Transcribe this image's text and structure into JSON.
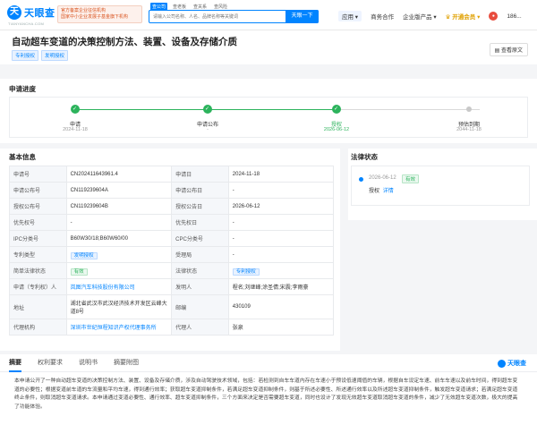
{
  "header": {
    "logo_mark": "天",
    "logo_text": "天眼查",
    "logo_sub": "TIANYANCHA.COM",
    "slogan_line1": "官方备案企业征信机构",
    "slogan_line2": "国家中小企业发展子基金旗下机构",
    "search_tabs": [
      "查公司",
      "查老板",
      "查关系",
      "查风险"
    ],
    "search_placeholder": "请输入公司名称、人名、品牌名称等关键词",
    "search_button": "天眼一下",
    "nav_app": "应用 ▾",
    "nav_items": [
      "商务合作",
      "企业版产品 ▾"
    ],
    "nav_vip": "♛ 开通会员 ▾",
    "nav_user": "186..."
  },
  "title": {
    "text": "自动超车变道的决策控制方法、装置、设备及存储介质",
    "tags": [
      "专利授权",
      "发明授权"
    ],
    "view_original": "查看原文"
  },
  "progress": {
    "title": "申请进度",
    "steps": [
      {
        "label": "申请",
        "date": "2024-11-18"
      },
      {
        "label": "申请公布",
        "date": "-"
      },
      {
        "label": "授权",
        "date": "2026-06-12"
      },
      {
        "label": "预估到期",
        "date": "2044-11-18"
      }
    ]
  },
  "basic_info": {
    "title": "基本信息",
    "rows": [
      {
        "k1": "申请号",
        "v1": "CN202411643961.4",
        "k2": "申请日",
        "v2": "2024-11-18"
      },
      {
        "k1": "申请公布号",
        "v1": "CN119239604A",
        "k2": "申请公布日",
        "v2": "-"
      },
      {
        "k1": "授权公布号",
        "v1": "CN119239604B",
        "k2": "授权公告日",
        "v2": "2026-06-12"
      },
      {
        "k1": "优先权号",
        "v1": "-",
        "k2": "优先权日",
        "v2": "-"
      },
      {
        "k1": "IPC分类号",
        "v1": "B60W30/18;B60W60/00",
        "k2": "CPC分类号",
        "v2": "-"
      },
      {
        "k1": "专利类型",
        "v1": "发明授权",
        "k2": "受理局",
        "v2": "-"
      },
      {
        "k1": "简单法律状态",
        "v1": "有效",
        "k2": "法律状态",
        "v2": "专利授权"
      },
      {
        "k1": "申请（专利权）人",
        "v1": "岚图汽车科技股份有限公司",
        "k2": "发明人",
        "v2": "程名;刘继峰;涂圣倩;宋震;李雨豪"
      },
      {
        "k1": "地址",
        "v1": "湖北省武汉市武汉经济技术开发区云峰大道8号",
        "k2": "邮编",
        "v2": "430109"
      },
      {
        "k1": "代理机构",
        "v1": "深圳市世纪恒程知识产权代理事务所",
        "k2": "代理人",
        "v2": "张泉"
      }
    ]
  },
  "legal_status": {
    "title": "法律状态",
    "date": "2026-06-12",
    "badge": "有效",
    "text": "授权",
    "detail": "详情"
  },
  "tabs": {
    "items": [
      "摘要",
      "权利要求",
      "说明书",
      "摘要附图"
    ],
    "brand": "天眼查"
  },
  "abstract": "本申请公开了一种自动超车变道的决策控制方法、装置、设备及存储介质，涉及自动驾驶技术领域，包括：若检测到自车车道内存在车速小于预设低速阈值的车辆，根据自车设定车速、前车车速以及前车时间，得到超车变道的必要性；根据变道前车道的车流量和平均车速，得到通行效率；获取超车变道抑制条件，若满足超车变道抑制条件，则基于所述必要性、所述通行效率以及所述超车变道抑制条件，触发超车变道请求；若满足超车变道终止条件，则取消超车变道请求。本申请通过变道必要性、通行效率、超车变道抑制条件，三个方面来决定是否需要超车变道，同时也设计了发现无效超车变道取消超车变道的条件，减少了无效超车变道次数，极大的提高了功能体验。"
}
